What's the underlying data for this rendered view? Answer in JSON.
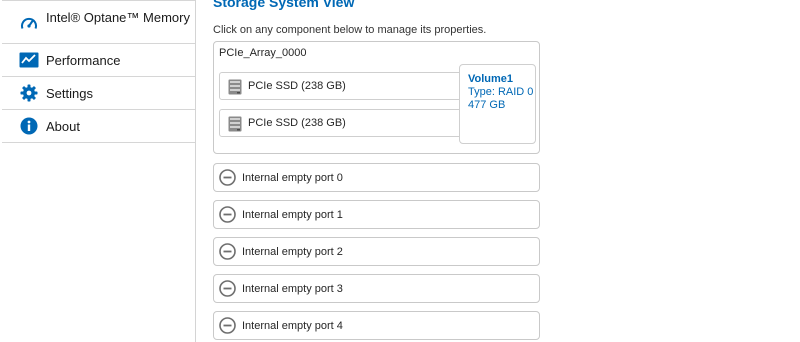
{
  "sidebar": {
    "items": [
      {
        "label": "Intel® Optane™ Memory",
        "icon": "gauge-icon"
      },
      {
        "label": "Performance",
        "icon": "performance-chart-icon"
      },
      {
        "label": "Settings",
        "icon": "gear-icon"
      },
      {
        "label": "About",
        "icon": "info-icon"
      }
    ]
  },
  "main": {
    "title": "Storage System View",
    "instruction": "Click on any component below to manage its properties.",
    "array": {
      "name": "PCIe_Array_0000",
      "disks": [
        {
          "label": "PCIe SSD (238 GB)",
          "icon": "ssd-icon"
        },
        {
          "label": "PCIe SSD (238 GB)",
          "icon": "ssd-icon"
        }
      ],
      "volume": {
        "name": "Volume1",
        "type": "Type: RAID 0",
        "size": "477 GB"
      }
    },
    "ports": [
      {
        "label": "Internal empty port 0",
        "icon": "empty-port-icon"
      },
      {
        "label": "Internal empty port 1",
        "icon": "empty-port-icon"
      },
      {
        "label": "Internal empty port 2",
        "icon": "empty-port-icon"
      },
      {
        "label": "Internal empty port 3",
        "icon": "empty-port-icon"
      },
      {
        "label": "Internal empty port 4",
        "icon": "empty-port-icon"
      }
    ]
  },
  "colors": {
    "accent": "#0068b5",
    "border": "#c9c9c9",
    "icon_gray": "#6e6e6e"
  }
}
